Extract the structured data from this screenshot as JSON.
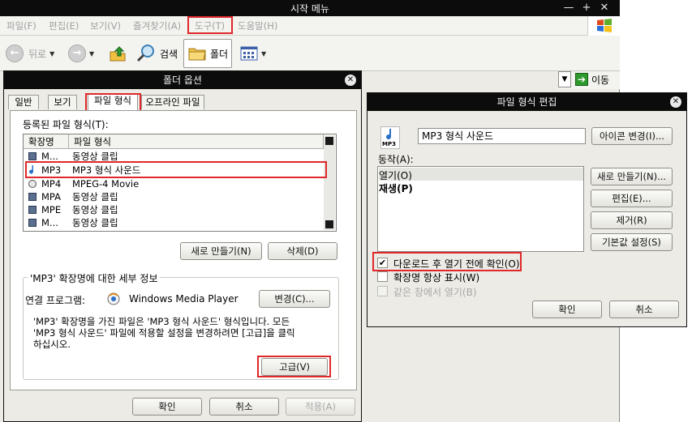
{
  "main_window": {
    "title": "시작 메뉴",
    "controls": [
      "—",
      "+",
      "✕"
    ],
    "menu": [
      "파일(F)",
      "편집(E)",
      "보기(V)",
      "즐겨찾기(A)",
      "도구(T)",
      "도움말(H)"
    ],
    "toolbar": {
      "back_label": "뒤로",
      "search_label": "검색",
      "folders_label": "폴더"
    },
    "go_label": "이동"
  },
  "folder_options": {
    "title": "폴더 옵션",
    "tabs": [
      "일반",
      "보기",
      "파일 형식",
      "오프라인 파일"
    ],
    "registered_label": "등록된 파일 형식(T):",
    "columns": [
      "확장명",
      "파일 형식"
    ],
    "rows": [
      {
        "ext": "M...",
        "type": "동영상 클립",
        "icon": "video-file-icon"
      },
      {
        "ext": "MP3",
        "type": "MP3 형식 사운드",
        "icon": "audio-file-icon"
      },
      {
        "ext": "MP4",
        "type": "MPEG-4 Movie",
        "icon": "media-file-icon"
      },
      {
        "ext": "MPA",
        "type": "동영상 클립",
        "icon": "video-file-icon"
      },
      {
        "ext": "MPE",
        "type": "동영상 클립",
        "icon": "video-file-icon"
      },
      {
        "ext": "M...",
        "type": "동영상 클립",
        "icon": "video-file-icon"
      }
    ],
    "new_button": "새로 만들기(N)",
    "delete_button": "삭제(D)",
    "details_group_title": "'MP3' 확장명에 대한 세부 정보",
    "opens_with_label": "연결 프로그램:",
    "program_name": "Windows Media Player",
    "change_button": "변경(C)...",
    "description_lines": [
      "'MP3' 확장명을 가진 파일은 'MP3 형식 사운드' 형식입니다. 모든",
      "'MP3 형식 사운드' 파일에 적용할 설정을 변경하려면 [고급]을 클릭",
      "하십시오."
    ],
    "advanced_button": "고급(V)",
    "ok_button": "확인",
    "cancel_button": "취소",
    "apply_button": "적용(A)"
  },
  "edit_file_type": {
    "title": "파일 형식 편집",
    "type_name": "MP3 형식 사운드",
    "icon_caption": "MP3",
    "change_icon_button": "아이콘 변경(I)...",
    "actions_label": "동작(A):",
    "actions": [
      "열기(O)",
      "재생(P)"
    ],
    "new_button": "새로 만들기(N)...",
    "edit_button": "편집(E)...",
    "remove_button": "제거(R)",
    "set_default_button": "기본값 설정(S)",
    "confirm_open_label": "다운로드 후 열기 전에 확인(O)",
    "always_show_ext_label": "확장명 항상 표시(W)",
    "browse_same_window_label": "같은 창에서 열기(B)",
    "ok_button": "확인",
    "cancel_button": "취소"
  },
  "colors": {
    "highlight_red": "#e0282a",
    "titlebar": "#0c0c0c",
    "dialog_bg": "#ecebe6"
  }
}
